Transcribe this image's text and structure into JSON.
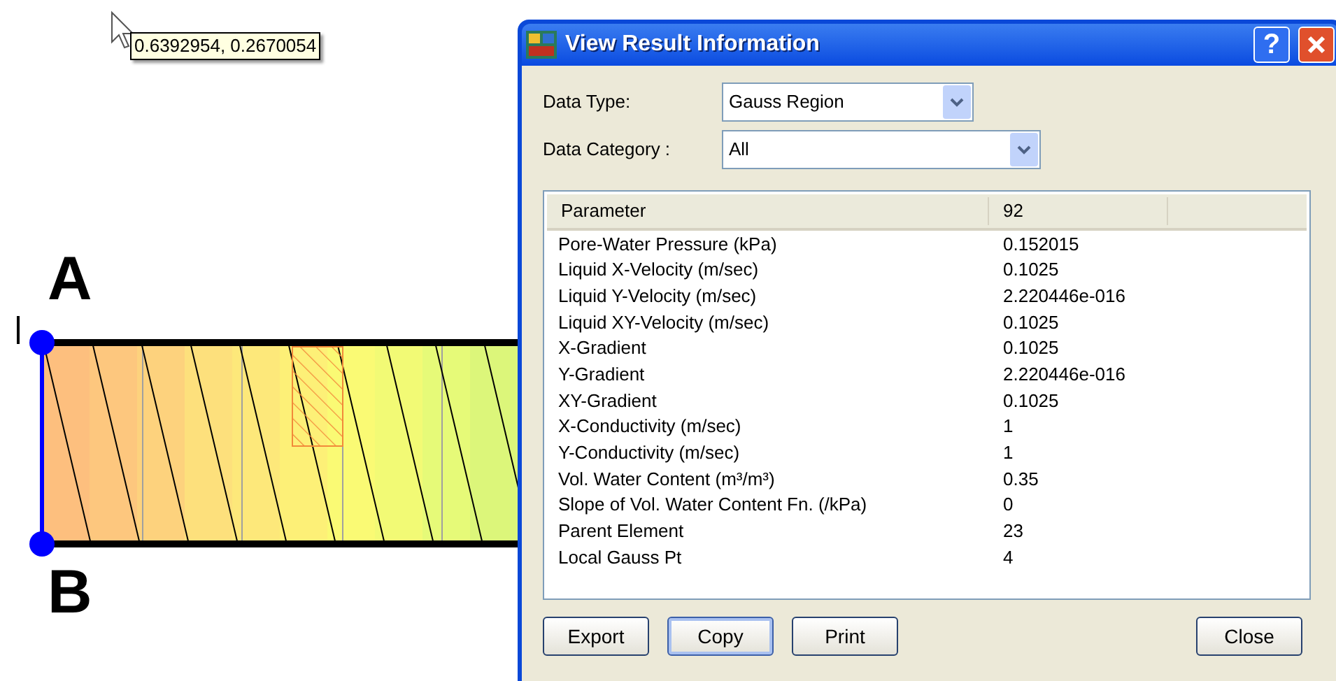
{
  "canvas": {
    "tooltip": "0.6392954, 0.2670054",
    "point_labels": [
      "A",
      "B"
    ]
  },
  "dialog": {
    "title": "View Result Information",
    "help_button": "?",
    "fields": [
      {
        "label": "Data Type:",
        "value": "Gauss Region"
      },
      {
        "label": "Data Category :",
        "value": "All"
      }
    ],
    "table": {
      "columns": [
        "Parameter",
        "92"
      ],
      "rows": [
        [
          "Pore-Water Pressure (kPa)",
          "0.152015"
        ],
        [
          "Liquid X-Velocity (m/sec)",
          "0.1025"
        ],
        [
          "Liquid Y-Velocity (m/sec)",
          "2.220446e-016"
        ],
        [
          "Liquid XY-Velocity (m/sec)",
          "0.1025"
        ],
        [
          "X-Gradient",
          "0.1025"
        ],
        [
          "Y-Gradient",
          "2.220446e-016"
        ],
        [
          "XY-Gradient",
          "0.1025"
        ],
        [
          "X-Conductivity (m/sec)",
          "1"
        ],
        [
          "Y-Conductivity (m/sec)",
          "1"
        ],
        [
          "Vol. Water Content (m³/m³)",
          "0.35"
        ],
        [
          "Slope of Vol. Water Content Fn. (/kPa)",
          "0"
        ],
        [
          "Parent Element",
          "23"
        ],
        [
          "Local Gauss Pt",
          "4"
        ]
      ]
    },
    "buttons": [
      {
        "label": "Export",
        "focused": false
      },
      {
        "label": "Copy",
        "focused": true
      },
      {
        "label": "Print",
        "focused": false
      }
    ],
    "close_button": {
      "label": "Close",
      "focused": false
    }
  }
}
